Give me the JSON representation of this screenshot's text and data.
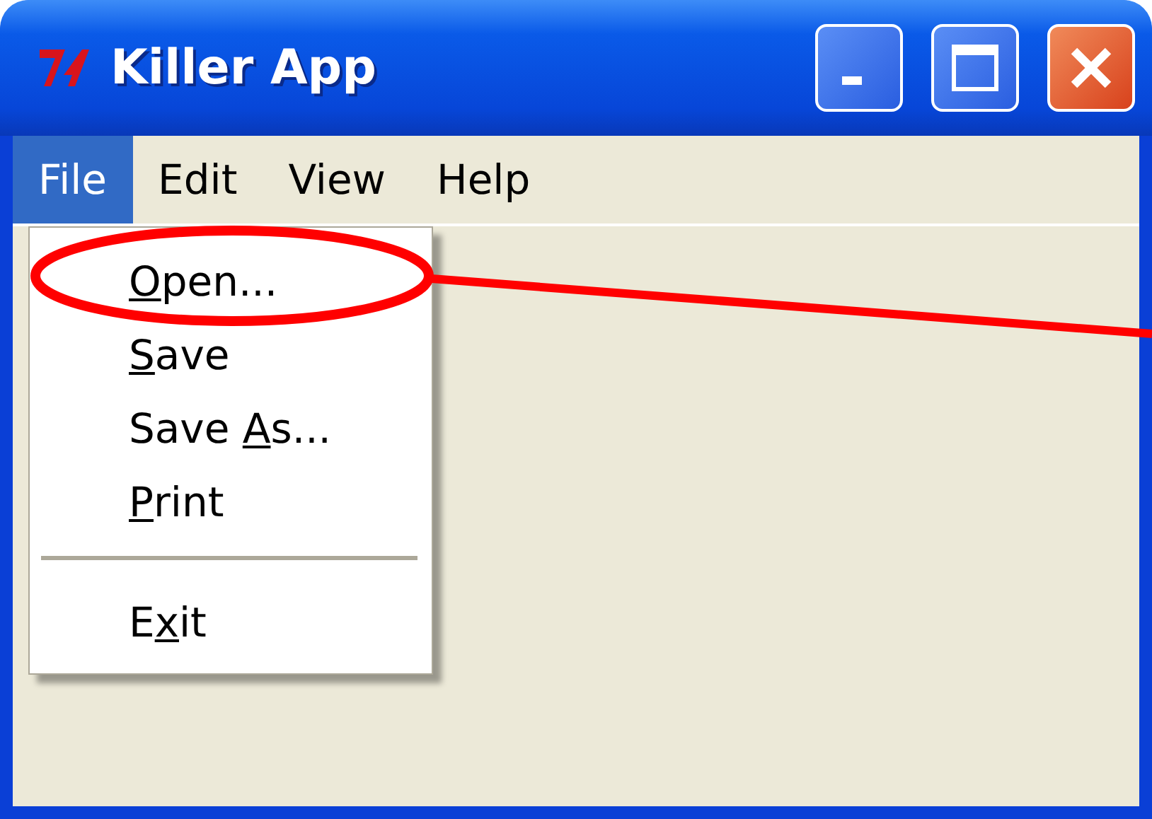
{
  "window": {
    "title": "Killer App"
  },
  "menu_bar": [
    {
      "label": "File",
      "selected": true
    },
    {
      "label": "Edit",
      "selected": false
    },
    {
      "label": "View",
      "selected": false
    },
    {
      "label": "Help",
      "selected": false
    }
  ],
  "file_menu": [
    {
      "kind": "item",
      "access_key": "O",
      "label_after": "pen..."
    },
    {
      "kind": "item",
      "access_key": "S",
      "label_after": "ave"
    },
    {
      "kind": "item",
      "label_before": "Save ",
      "access_key": "A",
      "label_after": "s..."
    },
    {
      "kind": "item",
      "access_key": "P",
      "label_after": "rint"
    },
    {
      "kind": "separator"
    },
    {
      "kind": "item",
      "label_before": "E",
      "access_key": "x",
      "label_after": "it"
    }
  ]
}
